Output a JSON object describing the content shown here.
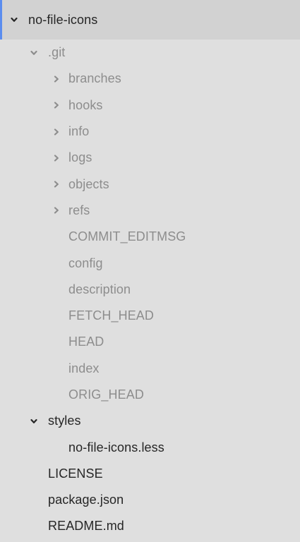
{
  "tree": {
    "root": {
      "label": "no-file-icons",
      "state": "expanded"
    },
    "git": {
      "label": ".git",
      "state": "expanded",
      "folders": [
        "branches",
        "hooks",
        "info",
        "logs",
        "objects",
        "refs"
      ],
      "files": [
        "COMMIT_EDITMSG",
        "config",
        "description",
        "FETCH_HEAD",
        "HEAD",
        "index",
        "ORIG_HEAD"
      ]
    },
    "styles": {
      "label": "styles",
      "state": "expanded",
      "files": [
        "no-file-icons.less"
      ]
    },
    "root_files": [
      "LICENSE",
      "package.json",
      "README.md"
    ]
  },
  "colors": {
    "background": "#dfdfdf",
    "selected_row": "#d2d2d2",
    "selection_indicator": "#5b8def",
    "ignored_text": "#8d8d8d",
    "normal_text": "#262626"
  },
  "icons": {
    "expanded": "chevron-down-icon",
    "collapsed": "chevron-right-icon"
  }
}
